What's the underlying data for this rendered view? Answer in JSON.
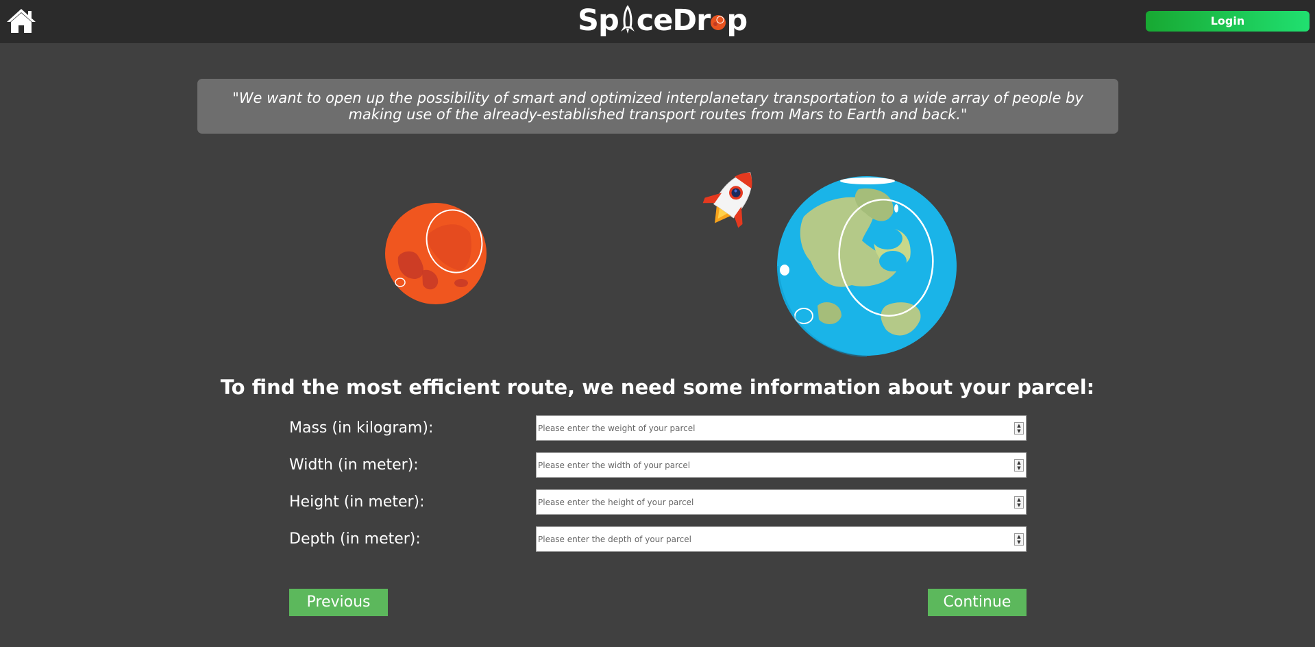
{
  "header": {
    "home_icon": "home-icon",
    "logo": {
      "part1": "Sp",
      "part2": "ceDr",
      "part3": "p"
    },
    "login_label": "Login"
  },
  "quote": "\"We want to open up the possibility of smart and optimized interplanetary transportation to a wide array of people by making use of the already-established transport routes from Mars to Earth and back.\"",
  "illustration": {
    "icons": [
      "mars-planet-icon",
      "rocket-icon",
      "earth-planet-icon"
    ]
  },
  "form": {
    "heading": "To find the most efficient route, we need some information about your parcel:",
    "fields": [
      {
        "label": "Mass (in kilogram):",
        "placeholder": "Please enter the weight of your parcel",
        "value": ""
      },
      {
        "label": "Width (in meter):",
        "placeholder": "Please enter the width of your parcel",
        "value": ""
      },
      {
        "label": "Height (in meter):",
        "placeholder": "Please enter the height of your parcel",
        "value": ""
      },
      {
        "label": "Depth (in meter):",
        "placeholder": "Please enter the depth of your parcel",
        "value": ""
      }
    ],
    "previous_label": "Previous",
    "continue_label": "Continue"
  },
  "colors": {
    "background": "#404040",
    "topbar": "#2b2b2b",
    "accent_green": "#5cb85c",
    "login_green": "#20e070"
  }
}
